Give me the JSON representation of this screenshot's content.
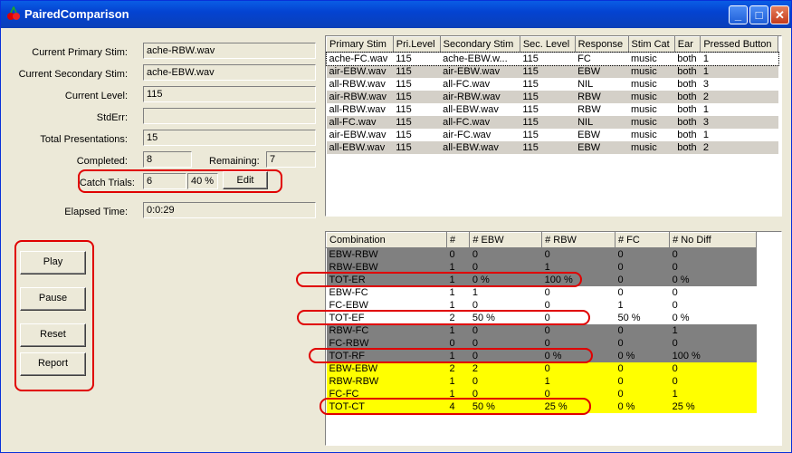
{
  "window": {
    "title": "PairedComparison",
    "min": "_",
    "max": "□",
    "close": "✕"
  },
  "info": {
    "primary_label": "Current Primary Stim:",
    "primary_value": "ache-RBW.wav",
    "secondary_label": "Current Secondary Stim:",
    "secondary_value": "ache-EBW.wav",
    "level_label": "Current Level:",
    "level_value": "115",
    "stderr_label": "StdErr:",
    "stderr_value": "",
    "total_label": "Total Presentations:",
    "total_value": "15",
    "completed_label": "Completed:",
    "completed_value": "8",
    "remaining_label": "Remaining:",
    "remaining_value": "7",
    "catch_label": "Catch Trials:",
    "catch_value": "6",
    "catch_pct": "40 %",
    "edit_label": "Edit",
    "elapsed_label": "Elapsed Time:",
    "elapsed_value": "0:0:29"
  },
  "buttons": {
    "play": "Play",
    "pause": "Pause",
    "reset": "Reset",
    "report": "Report"
  },
  "trials": {
    "headers": [
      "Primary Stim",
      "Pri.Level",
      "Secondary Stim",
      "Sec. Level",
      "Response",
      "Stim Cat",
      "Ear",
      "Pressed Button"
    ],
    "rows": [
      [
        "ache-FC.wav",
        "115",
        "ache-EBW.w...",
        "115",
        "FC",
        "music",
        "both",
        "1"
      ],
      [
        "air-EBW.wav",
        "115",
        "air-EBW.wav",
        "115",
        "EBW",
        "music",
        "both",
        "1"
      ],
      [
        "all-RBW.wav",
        "115",
        "all-FC.wav",
        "115",
        "NIL",
        "music",
        "both",
        "3"
      ],
      [
        "air-RBW.wav",
        "115",
        "air-RBW.wav",
        "115",
        "RBW",
        "music",
        "both",
        "2"
      ],
      [
        "all-RBW.wav",
        "115",
        "all-EBW.wav",
        "115",
        "RBW",
        "music",
        "both",
        "1"
      ],
      [
        "all-FC.wav",
        "115",
        "all-FC.wav",
        "115",
        "NIL",
        "music",
        "both",
        "3"
      ],
      [
        "air-EBW.wav",
        "115",
        "air-FC.wav",
        "115",
        "EBW",
        "music",
        "both",
        "1"
      ],
      [
        "all-EBW.wav",
        "115",
        "all-EBW.wav",
        "115",
        "EBW",
        "music",
        "both",
        "2"
      ]
    ]
  },
  "summary": {
    "headers": [
      "Combination",
      "#",
      "# EBW",
      "# RBW",
      "# FC",
      "# No Diff"
    ],
    "rows": [
      {
        "style": "grey",
        "cells": [
          "EBW-RBW",
          "0",
          "0",
          "0",
          "0",
          "0"
        ]
      },
      {
        "style": "grey",
        "cells": [
          "RBW-EBW",
          "1",
          "0",
          "1",
          "0",
          "0"
        ]
      },
      {
        "style": "grey",
        "cells": [
          "TOT-ER",
          "1",
          "0 %",
          "100 %",
          "0",
          "0 %"
        ]
      },
      {
        "style": "white",
        "cells": [
          "EBW-FC",
          "1",
          "1",
          "0",
          "0",
          "0"
        ]
      },
      {
        "style": "white",
        "cells": [
          "FC-EBW",
          "1",
          "0",
          "0",
          "1",
          "0"
        ]
      },
      {
        "style": "white",
        "cells": [
          "TOT-EF",
          "2",
          "50 %",
          "0",
          "50 %",
          "0 %"
        ]
      },
      {
        "style": "grey",
        "cells": [
          "RBW-FC",
          "1",
          "0",
          "0",
          "0",
          "1"
        ]
      },
      {
        "style": "grey",
        "cells": [
          "FC-RBW",
          "0",
          "0",
          "0",
          "0",
          "0"
        ]
      },
      {
        "style": "grey",
        "cells": [
          "TOT-RF",
          "1",
          "0",
          "0 %",
          "0 %",
          "100 %"
        ]
      },
      {
        "style": "yellow",
        "cells": [
          "EBW-EBW",
          "2",
          "2",
          "0",
          "0",
          "0"
        ]
      },
      {
        "style": "yellow",
        "cells": [
          "RBW-RBW",
          "1",
          "0",
          "1",
          "0",
          "0"
        ]
      },
      {
        "style": "yellow",
        "cells": [
          "FC-FC",
          "1",
          "0",
          "0",
          "0",
          "1"
        ]
      },
      {
        "style": "yellow",
        "cells": [
          "TOT-CT",
          "4",
          "50 %",
          "25 %",
          "0 %",
          "25 %"
        ]
      }
    ]
  }
}
